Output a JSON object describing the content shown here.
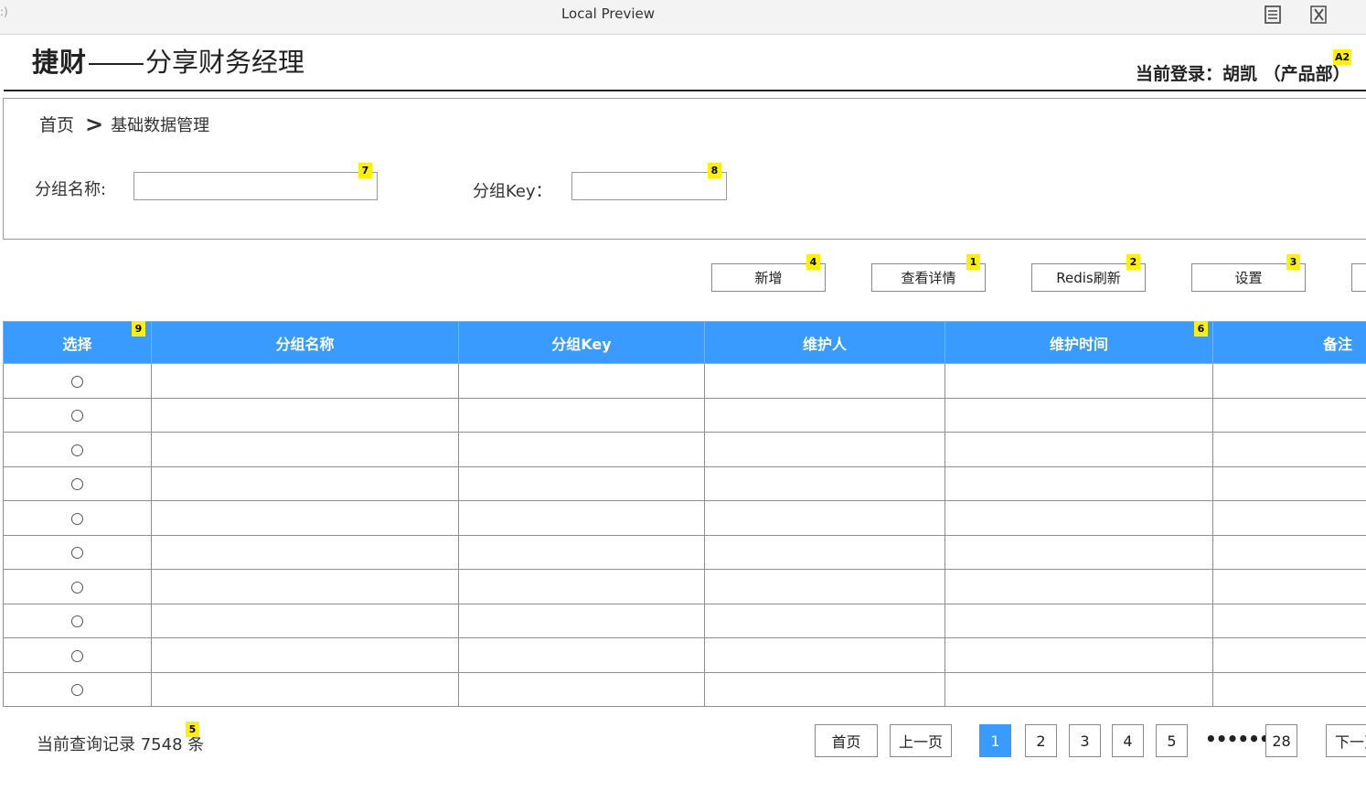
{
  "window": {
    "title": "Local Preview",
    "edge_glyph": ":)"
  },
  "header": {
    "brand_bold": "捷财",
    "brand_rest": "分享财务经理",
    "login_text": "当前登录：胡凯 （产品部）",
    "tag": "A2"
  },
  "breadcrumb": {
    "home": "首页",
    "separator": ">",
    "current": "基础数据管理"
  },
  "search": {
    "group_name_label": "分组名称:",
    "group_name_value": "",
    "group_name_tag": "7",
    "group_key_label": "分组Key：",
    "group_key_value": "",
    "group_key_tag": "8"
  },
  "toolbar": {
    "buttons": [
      {
        "label": "新增",
        "tag": "4"
      },
      {
        "label": "查看详情",
        "tag": "1"
      },
      {
        "label": "Redis刷新",
        "tag": "2"
      },
      {
        "label": "设置",
        "tag": "3"
      }
    ]
  },
  "table": {
    "headers": [
      "选择",
      "分组名称",
      "分组Key",
      "维护人",
      "维护时间",
      "备注"
    ],
    "select_tag": "9",
    "time_tag": "6",
    "rows": [
      [
        "",
        "",
        "",
        "",
        ""
      ],
      [
        "",
        "",
        "",
        "",
        ""
      ],
      [
        "",
        "",
        "",
        "",
        ""
      ],
      [
        "",
        "",
        "",
        "",
        ""
      ],
      [
        "",
        "",
        "",
        "",
        ""
      ],
      [
        "",
        "",
        "",
        "",
        ""
      ],
      [
        "",
        "",
        "",
        "",
        ""
      ],
      [
        "",
        "",
        "",
        "",
        ""
      ],
      [
        "",
        "",
        "",
        "",
        ""
      ],
      [
        "",
        "",
        "",
        "",
        ""
      ]
    ]
  },
  "footer": {
    "total_text": "当前查询记录 7548 条",
    "total_tag": "5",
    "first": "首页",
    "prev": "上一页",
    "pages": [
      "1",
      "2",
      "3",
      "4",
      "5"
    ],
    "active_page": "1",
    "ellipsis": "••••••",
    "last_page": "28",
    "next": "下一页"
  }
}
